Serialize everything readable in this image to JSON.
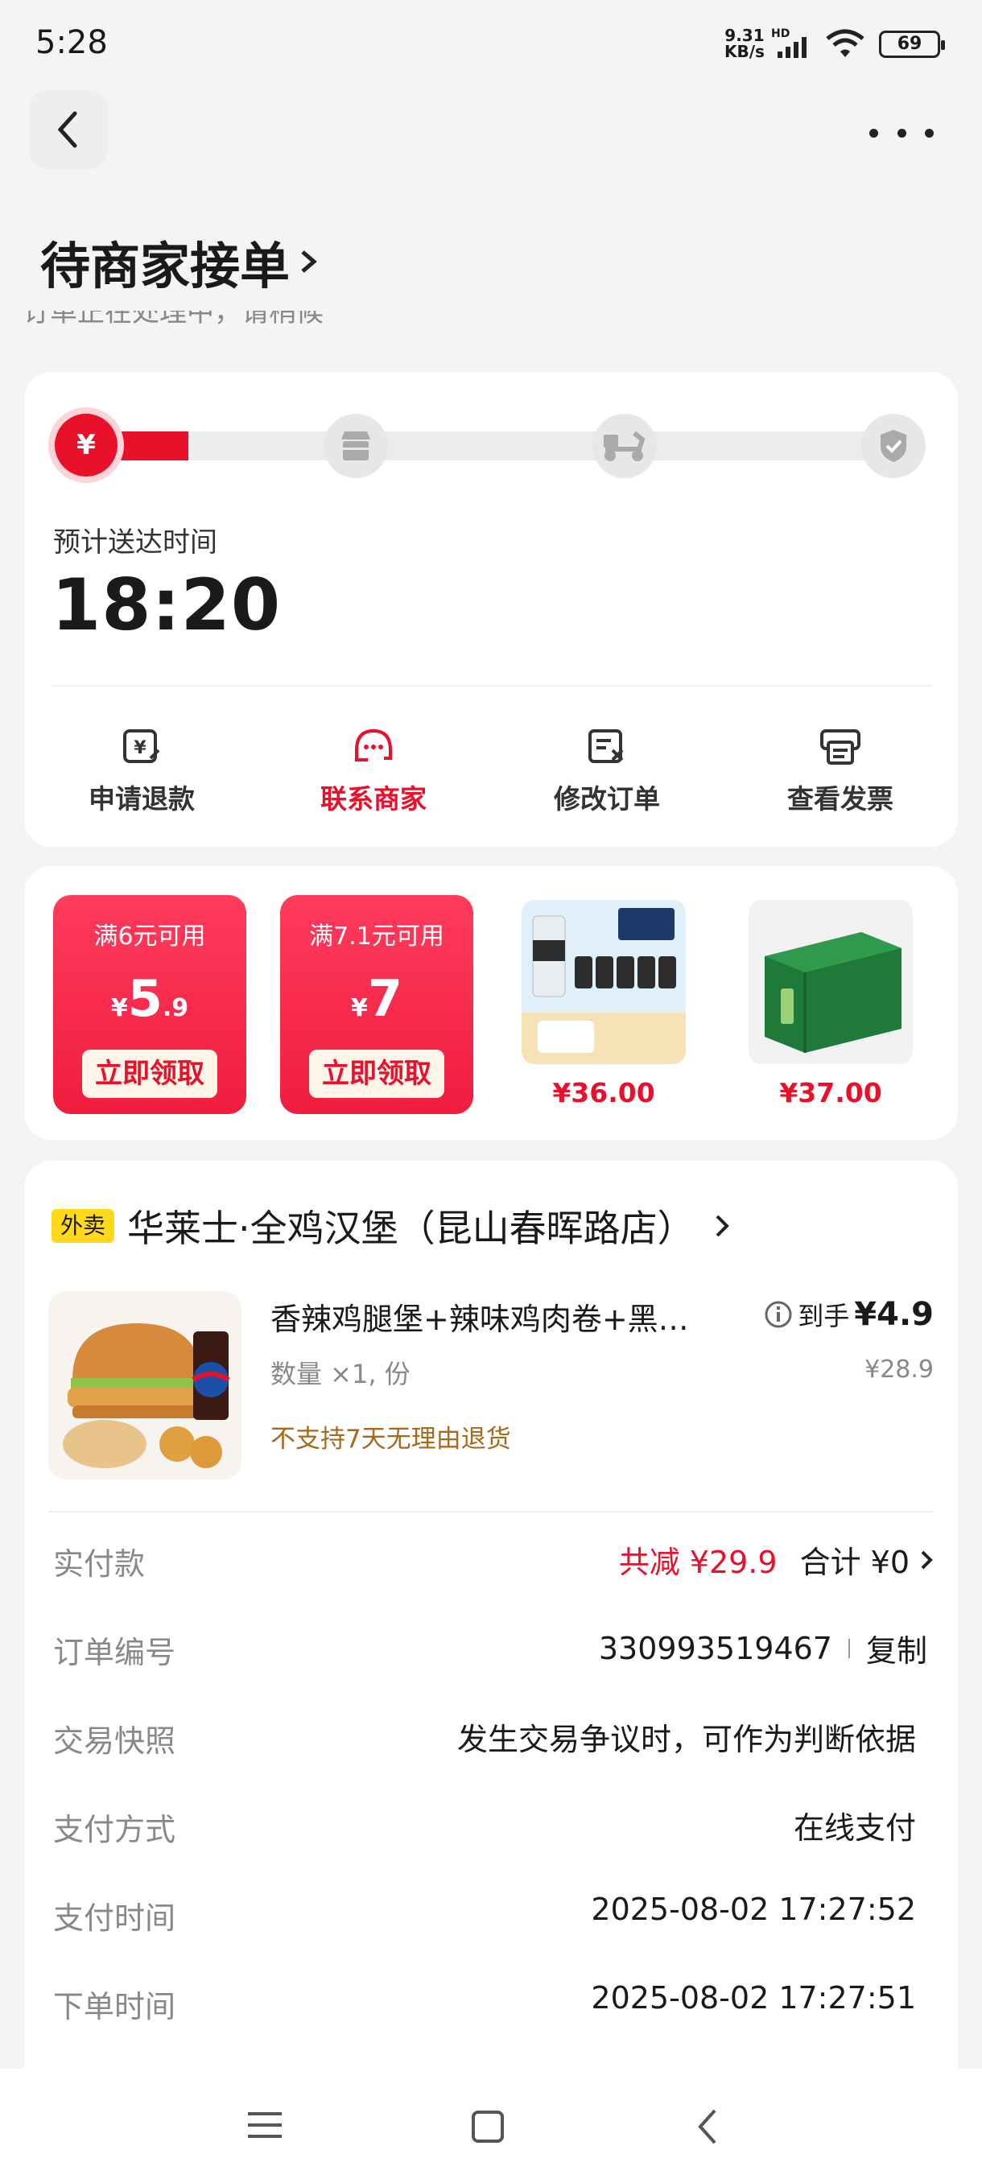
{
  "status_bar": {
    "time": "5:28",
    "net_speed_top": "9.31",
    "net_speed_bottom": "KB/s",
    "hd": "HD",
    "battery": "69"
  },
  "header": {
    "title": "待商家接单",
    "subtitle": "订单正在处理中，请稍候"
  },
  "progress": {
    "steps": [
      "payment",
      "store",
      "delivery",
      "done"
    ],
    "current_step": 1,
    "active_symbol": "¥",
    "eta_label": "预计送达时间",
    "eta_time": "18:20"
  },
  "actions": [
    {
      "label": "申请退款",
      "icon": "refund-icon"
    },
    {
      "label": "联系商家",
      "icon": "merchant-chat-icon"
    },
    {
      "label": "修改订单",
      "icon": "edit-order-icon"
    },
    {
      "label": "查看发票",
      "icon": "invoice-icon"
    }
  ],
  "coupons": [
    {
      "condition": "满6元可用",
      "currency": "¥",
      "int": "5",
      "dec": ".9",
      "button": "立即领取"
    },
    {
      "condition": "满7.1元可用",
      "currency": "¥",
      "int": "7",
      "dec": "",
      "button": "立即领取"
    }
  ],
  "recommend_products": [
    {
      "price": "¥36.00"
    },
    {
      "price": "¥37.00"
    }
  ],
  "shop": {
    "tag": "外卖",
    "name": "华莱士·全鸡汉堡（昆山春晖路店）"
  },
  "item": {
    "name": "香辣鸡腿堡+辣味鸡肉卷+黑…",
    "quantity": "数量 ×1, 份",
    "policy": "不支持7天无理由退货",
    "final_prefix": "到手",
    "final_price": "¥4.9",
    "original_price": "¥28.9"
  },
  "details": {
    "paid_label": "实付款",
    "discount": "共减 ¥29.9",
    "total": "合计 ¥0",
    "order_no_label": "订单编号",
    "order_no": "330993519467",
    "copy": "复制",
    "snapshot_label": "交易快照",
    "snapshot_value": "发生交易争议时，可作为判断依据",
    "pay_method_label": "支付方式",
    "pay_method": "在线支付",
    "pay_time_label": "支付时间",
    "pay_time": "2025-08-02 17:27:52",
    "order_time_label": "下单时间",
    "order_time": "2025-08-02 17:27:51"
  },
  "colors": {
    "accent": "#e8102b",
    "background": "#f4f4f4",
    "policy": "#a8691a",
    "tag": "#ffd91a"
  }
}
